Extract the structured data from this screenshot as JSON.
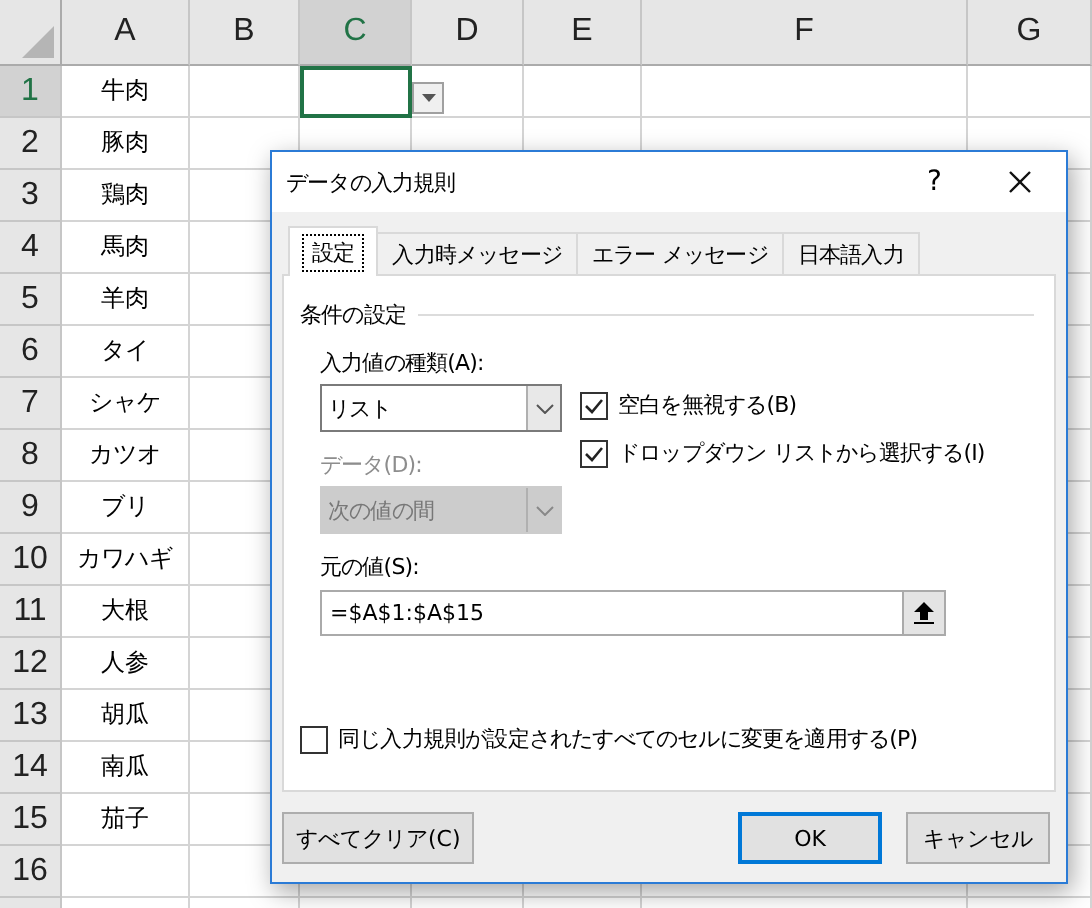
{
  "sheet": {
    "columns": [
      {
        "label": "A",
        "selected": false
      },
      {
        "label": "B",
        "selected": false
      },
      {
        "label": "C",
        "selected": true
      },
      {
        "label": "D",
        "selected": false
      },
      {
        "label": "E",
        "selected": false
      },
      {
        "label": "F",
        "selected": false
      },
      {
        "label": "G",
        "selected": false
      }
    ],
    "rows": [
      {
        "number": "1",
        "selected": true,
        "cell_a": "牛肉"
      },
      {
        "number": "2",
        "selected": false,
        "cell_a": "豚肉"
      },
      {
        "number": "3",
        "selected": false,
        "cell_a": "鶏肉"
      },
      {
        "number": "4",
        "selected": false,
        "cell_a": "馬肉"
      },
      {
        "number": "5",
        "selected": false,
        "cell_a": "羊肉"
      },
      {
        "number": "6",
        "selected": false,
        "cell_a": "タイ"
      },
      {
        "number": "7",
        "selected": false,
        "cell_a": "シャケ"
      },
      {
        "number": "8",
        "selected": false,
        "cell_a": "カツオ"
      },
      {
        "number": "9",
        "selected": false,
        "cell_a": "ブリ"
      },
      {
        "number": "10",
        "selected": false,
        "cell_a": "カワハギ"
      },
      {
        "number": "11",
        "selected": false,
        "cell_a": "大根"
      },
      {
        "number": "12",
        "selected": false,
        "cell_a": "人参"
      },
      {
        "number": "13",
        "selected": false,
        "cell_a": "胡瓜"
      },
      {
        "number": "14",
        "selected": false,
        "cell_a": "南瓜"
      },
      {
        "number": "15",
        "selected": false,
        "cell_a": "茄子"
      },
      {
        "number": "16",
        "selected": false,
        "cell_a": ""
      }
    ]
  },
  "dialog": {
    "title": "データの入力規則",
    "help": "?",
    "tabs": [
      {
        "label": "設定",
        "selected": true
      },
      {
        "label": "入力時メッセージ",
        "selected": false
      },
      {
        "label": "エラー メッセージ",
        "selected": false
      },
      {
        "label": "日本語入力",
        "selected": false
      }
    ],
    "group_title": "条件の設定",
    "allow": {
      "label": "入力値の種類(A):",
      "value": "リスト",
      "disabled": false
    },
    "data": {
      "label": "データ(D):",
      "value": "次の値の間",
      "disabled": true
    },
    "options": [
      {
        "label": "空白を無視する(B)",
        "checked": true
      },
      {
        "label": "ドロップダウン リストから選択する(I)",
        "checked": true
      }
    ],
    "source": {
      "label": "元の値(S):",
      "value": "=$A$1:$A$15"
    },
    "apply_all": {
      "label": "同じ入力規則が設定されたすべてのセルに変更を適用する(P)",
      "checked": false
    },
    "buttons": [
      {
        "label": "すべてクリア(C)",
        "kind": "plain"
      },
      {
        "label": "OK",
        "kind": "default"
      },
      {
        "label": "キャンセル",
        "kind": "plain"
      }
    ]
  }
}
